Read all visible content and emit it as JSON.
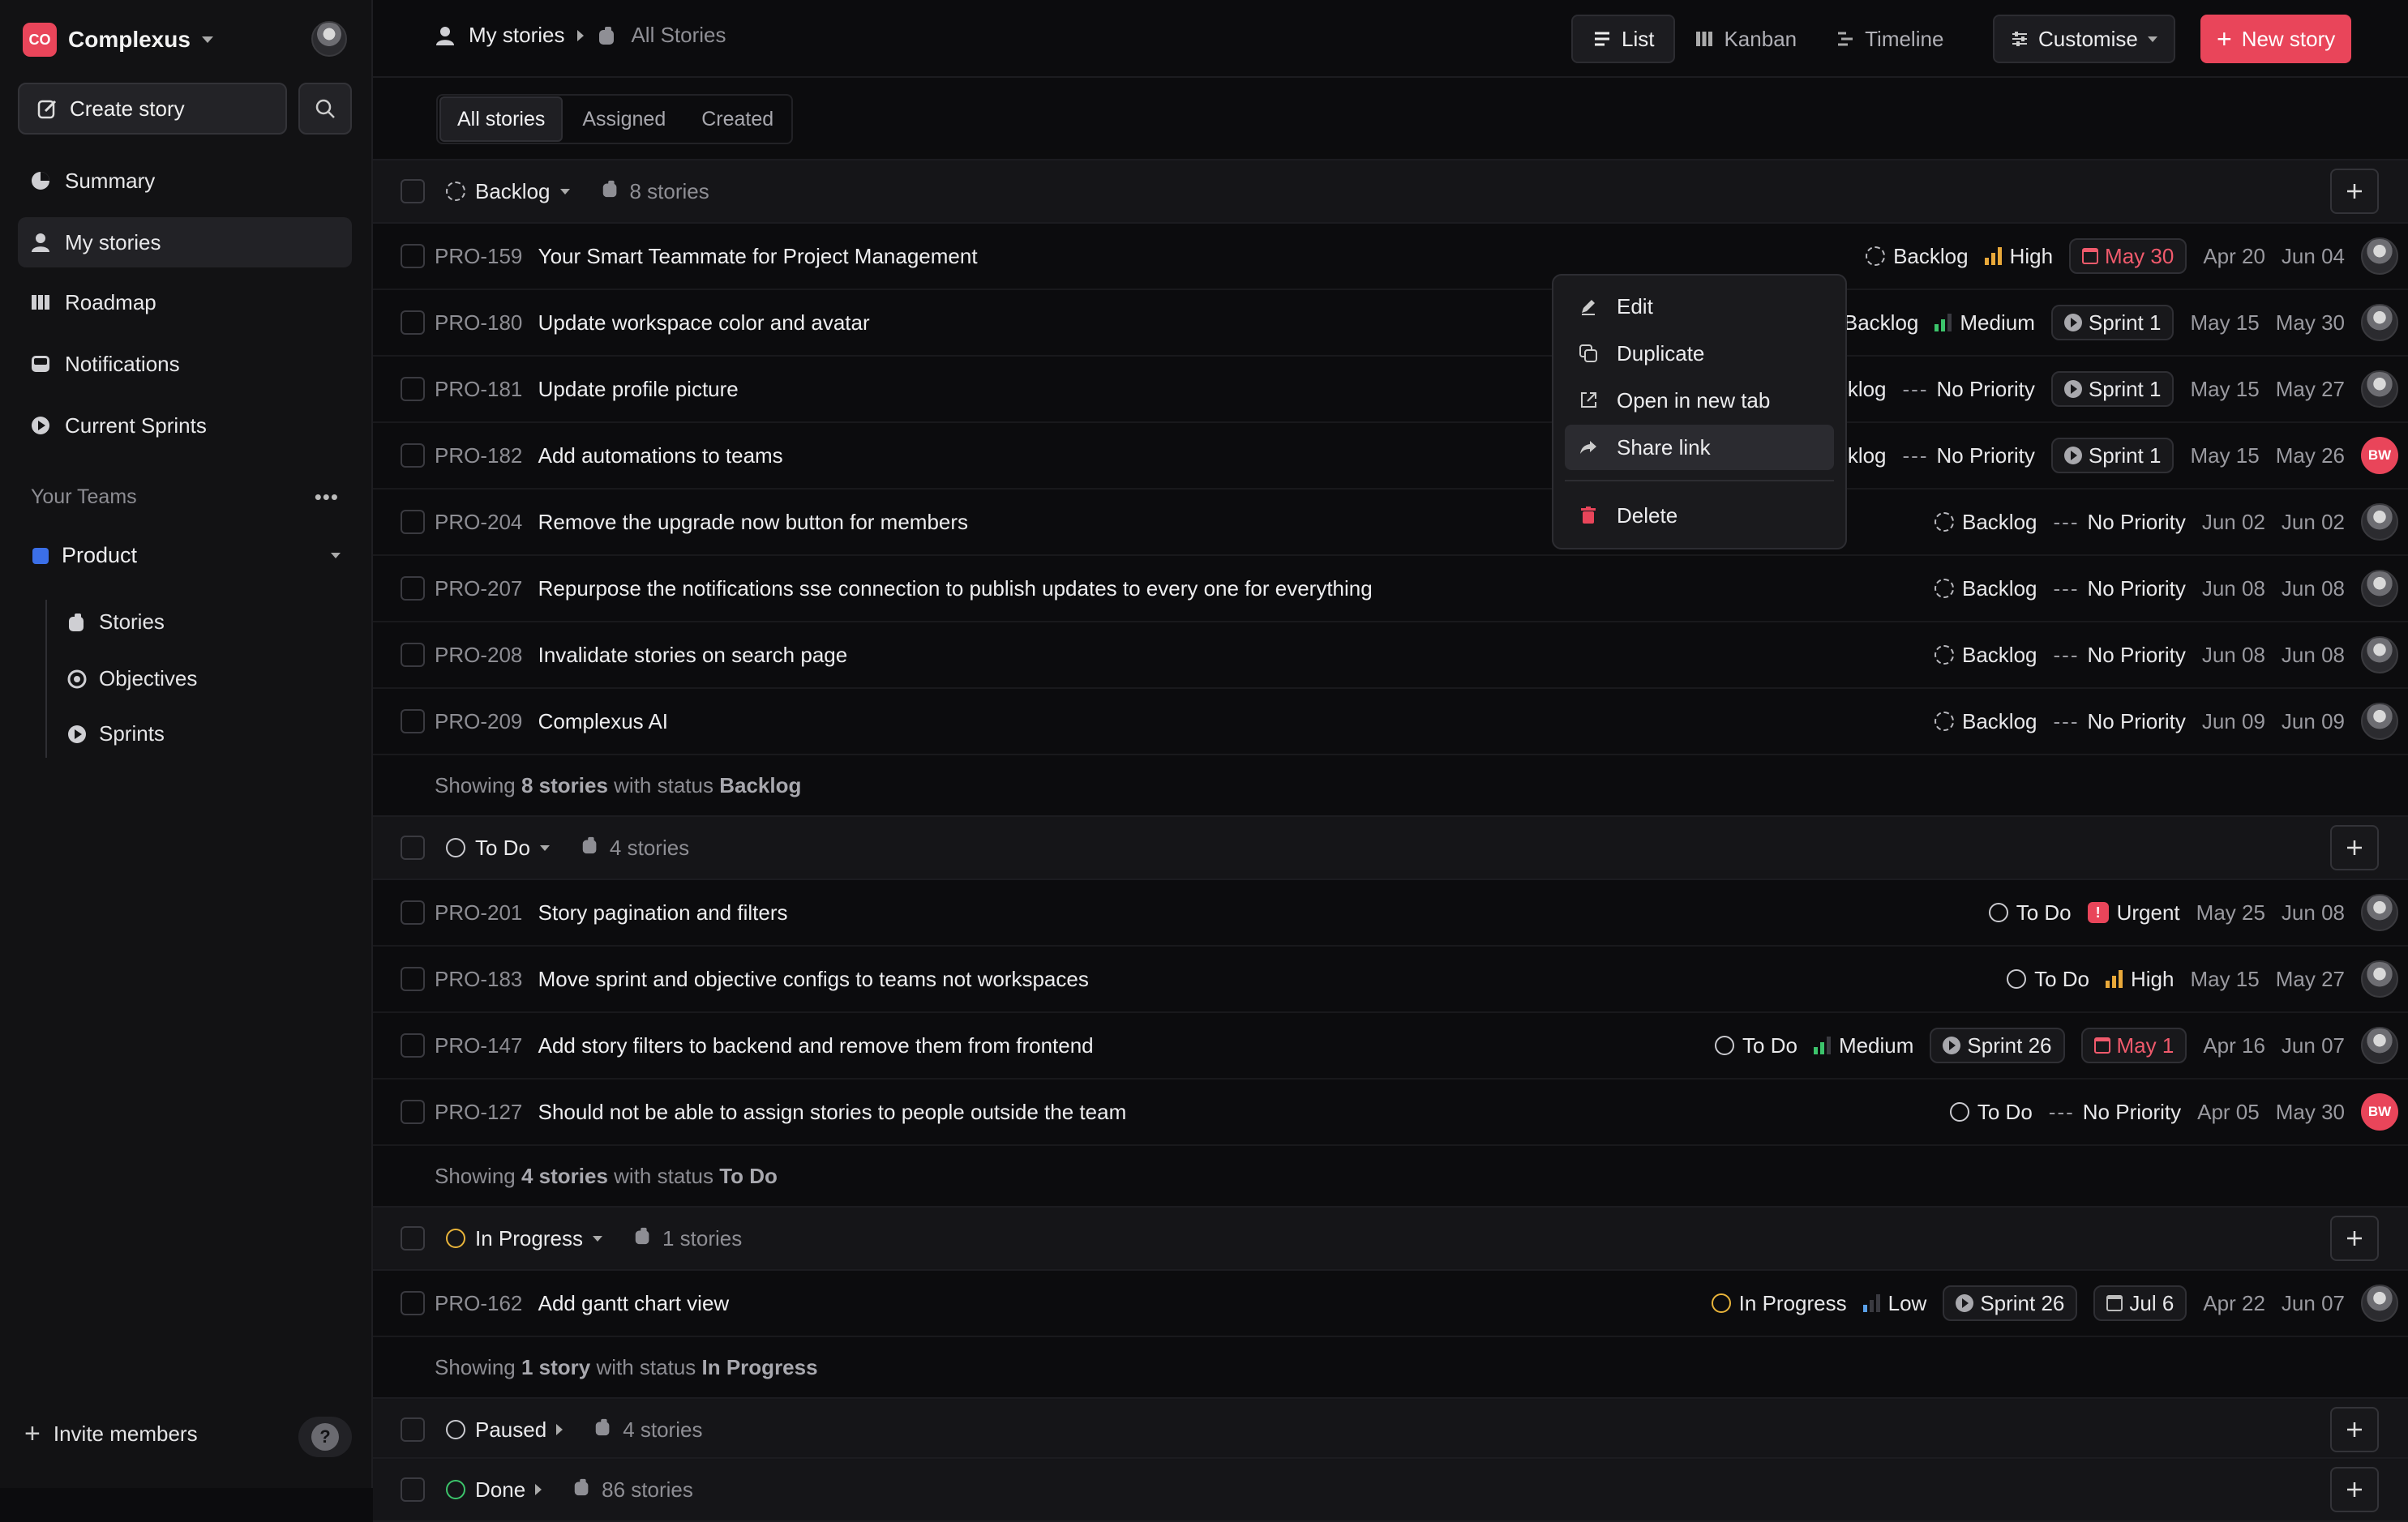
{
  "workspace": {
    "logo": "CO",
    "name": "Complexus"
  },
  "sidebar": {
    "create_label": "Create story",
    "nav": [
      {
        "label": "Summary",
        "icon": "summary-icon"
      },
      {
        "label": "My stories",
        "icon": "user-icon",
        "active": true
      },
      {
        "label": "Roadmap",
        "icon": "roadmap-icon"
      },
      {
        "label": "Notifications",
        "icon": "inbox-icon"
      },
      {
        "label": "Current Sprints",
        "icon": "sprint-icon"
      }
    ],
    "teams_heading": "Your Teams",
    "team_name": "Product",
    "team_color": "#3b6fe8",
    "team_items": [
      {
        "label": "Stories",
        "icon": "stories-icon"
      },
      {
        "label": "Objectives",
        "icon": "objectives-icon"
      },
      {
        "label": "Sprints",
        "icon": "sprint-icon"
      }
    ],
    "invite_label": "Invite members",
    "help_glyph": "?"
  },
  "header": {
    "breadcrumb_1": "My stories",
    "breadcrumb_2": "All Stories",
    "views": [
      {
        "label": "List",
        "active": true
      },
      {
        "label": "Kanban"
      },
      {
        "label": "Timeline"
      }
    ],
    "customise_label": "Customise",
    "new_story_label": "New story",
    "accent": "#e9455a"
  },
  "tabs": [
    {
      "label": "All stories",
      "active": true
    },
    {
      "label": "Assigned"
    },
    {
      "label": "Created"
    }
  ],
  "groups": [
    {
      "status": "Backlog",
      "count_label": "8 stories",
      "footer_pre": "Showing ",
      "footer_count": "8 stories",
      "footer_mid": " with status ",
      "footer_status": "Backlog",
      "rows": [
        {
          "id": "PRO-159",
          "title": "Your Smart Teammate for Project Management",
          "status": "Backlog",
          "priority": "High",
          "sprint": "",
          "due": "May 30",
          "start": "Apr 20",
          "end": "Jun 04",
          "avatar": "photo"
        },
        {
          "id": "PRO-180",
          "title": "Update workspace color and avatar",
          "status": "Backlog",
          "priority": "Medium",
          "sprint": "Sprint 1",
          "due": "",
          "start": "May 15",
          "end": "May 30",
          "avatar": "photo"
        },
        {
          "id": "PRO-181",
          "title": "Update profile picture",
          "status": "Backlog",
          "priority": "No Priority",
          "sprint": "Sprint 1",
          "due": "",
          "start": "May 15",
          "end": "May 27",
          "avatar": "photo"
        },
        {
          "id": "PRO-182",
          "title": "Add automations to teams",
          "status": "Backlog",
          "priority": "No Priority",
          "sprint": "Sprint 1",
          "due": "",
          "start": "May 15",
          "end": "May 26",
          "avatar": "BW"
        },
        {
          "id": "PRO-204",
          "title": "Remove the upgrade now button for members",
          "status": "Backlog",
          "priority": "No Priority",
          "sprint": "",
          "due": "",
          "start": "Jun 02",
          "end": "Jun 02",
          "avatar": "photo"
        },
        {
          "id": "PRO-207",
          "title": "Repurpose the notifications sse connection to publish updates to every one for everything",
          "status": "Backlog",
          "priority": "No Priority",
          "sprint": "",
          "due": "",
          "start": "Jun 08",
          "end": "Jun 08",
          "avatar": "photo"
        },
        {
          "id": "PRO-208",
          "title": "Invalidate stories on search page",
          "status": "Backlog",
          "priority": "No Priority",
          "sprint": "",
          "due": "",
          "start": "Jun 08",
          "end": "Jun 08",
          "avatar": "photo"
        },
        {
          "id": "PRO-209",
          "title": "Complexus AI",
          "status": "Backlog",
          "priority": "No Priority",
          "sprint": "",
          "due": "",
          "start": "Jun 09",
          "end": "Jun 09",
          "avatar": "photo"
        }
      ]
    },
    {
      "status": "To Do",
      "count_label": "4 stories",
      "footer_pre": "Showing ",
      "footer_count": "4 stories",
      "footer_mid": " with status ",
      "footer_status": "To Do",
      "rows": [
        {
          "id": "PRO-201",
          "title": "Story pagination and filters",
          "status": "To Do",
          "priority": "Urgent",
          "sprint": "",
          "due": "",
          "start": "May 25",
          "end": "Jun 08",
          "avatar": "photo"
        },
        {
          "id": "PRO-183",
          "title": "Move sprint and objective configs to teams not workspaces",
          "status": "To Do",
          "priority": "High",
          "sprint": "",
          "due": "",
          "start": "May 15",
          "end": "May 27",
          "avatar": "photo"
        },
        {
          "id": "PRO-147",
          "title": "Add story filters to backend and remove them from frontend",
          "status": "To Do",
          "priority": "Medium",
          "sprint": "Sprint 26",
          "due": "May 1",
          "start": "Apr 16",
          "end": "Jun 07",
          "avatar": "photo"
        },
        {
          "id": "PRO-127",
          "title": "Should not be able to assign stories to people outside the team",
          "status": "To Do",
          "priority": "No Priority",
          "sprint": "",
          "due": "",
          "start": "Apr 05",
          "end": "May 30",
          "avatar": "BW"
        }
      ]
    },
    {
      "status": "In Progress",
      "count_label": "1 stories",
      "footer_pre": "Showing ",
      "footer_count": "1 story",
      "footer_mid": " with status ",
      "footer_status": "In Progress",
      "rows": [
        {
          "id": "PRO-162",
          "title": "Add gantt chart view",
          "status": "In Progress",
          "priority": "Low",
          "sprint": "Sprint 26",
          "due": "Jul 6",
          "due_neutral": true,
          "start": "Apr 22",
          "end": "Jun 07",
          "avatar": "photo"
        }
      ]
    },
    {
      "status": "Paused",
      "count_label": "4 stories",
      "collapsed": true,
      "rows": []
    },
    {
      "status": "Done",
      "count_label": "86 stories",
      "collapsed": true,
      "rows": []
    }
  ],
  "context_menu": {
    "items": [
      {
        "label": "Edit",
        "icon": "pencil-icon"
      },
      {
        "label": "Duplicate",
        "icon": "duplicate-icon"
      },
      {
        "label": "Open in new tab",
        "icon": "external-link-icon"
      },
      {
        "label": "Share link",
        "icon": "share-icon",
        "highlighted": true
      }
    ],
    "danger": {
      "label": "Delete",
      "icon": "trash-icon",
      "color": "#e9455a"
    }
  },
  "colors": {
    "backlog": "#b9b9be",
    "todo": "#c9c9ce",
    "in_progress": "#e9b43a",
    "done": "#3cc46b",
    "high": "#e9a93a",
    "medium": "#3cc46b",
    "low": "#5aa0e8",
    "urgent": "#e9455a"
  }
}
